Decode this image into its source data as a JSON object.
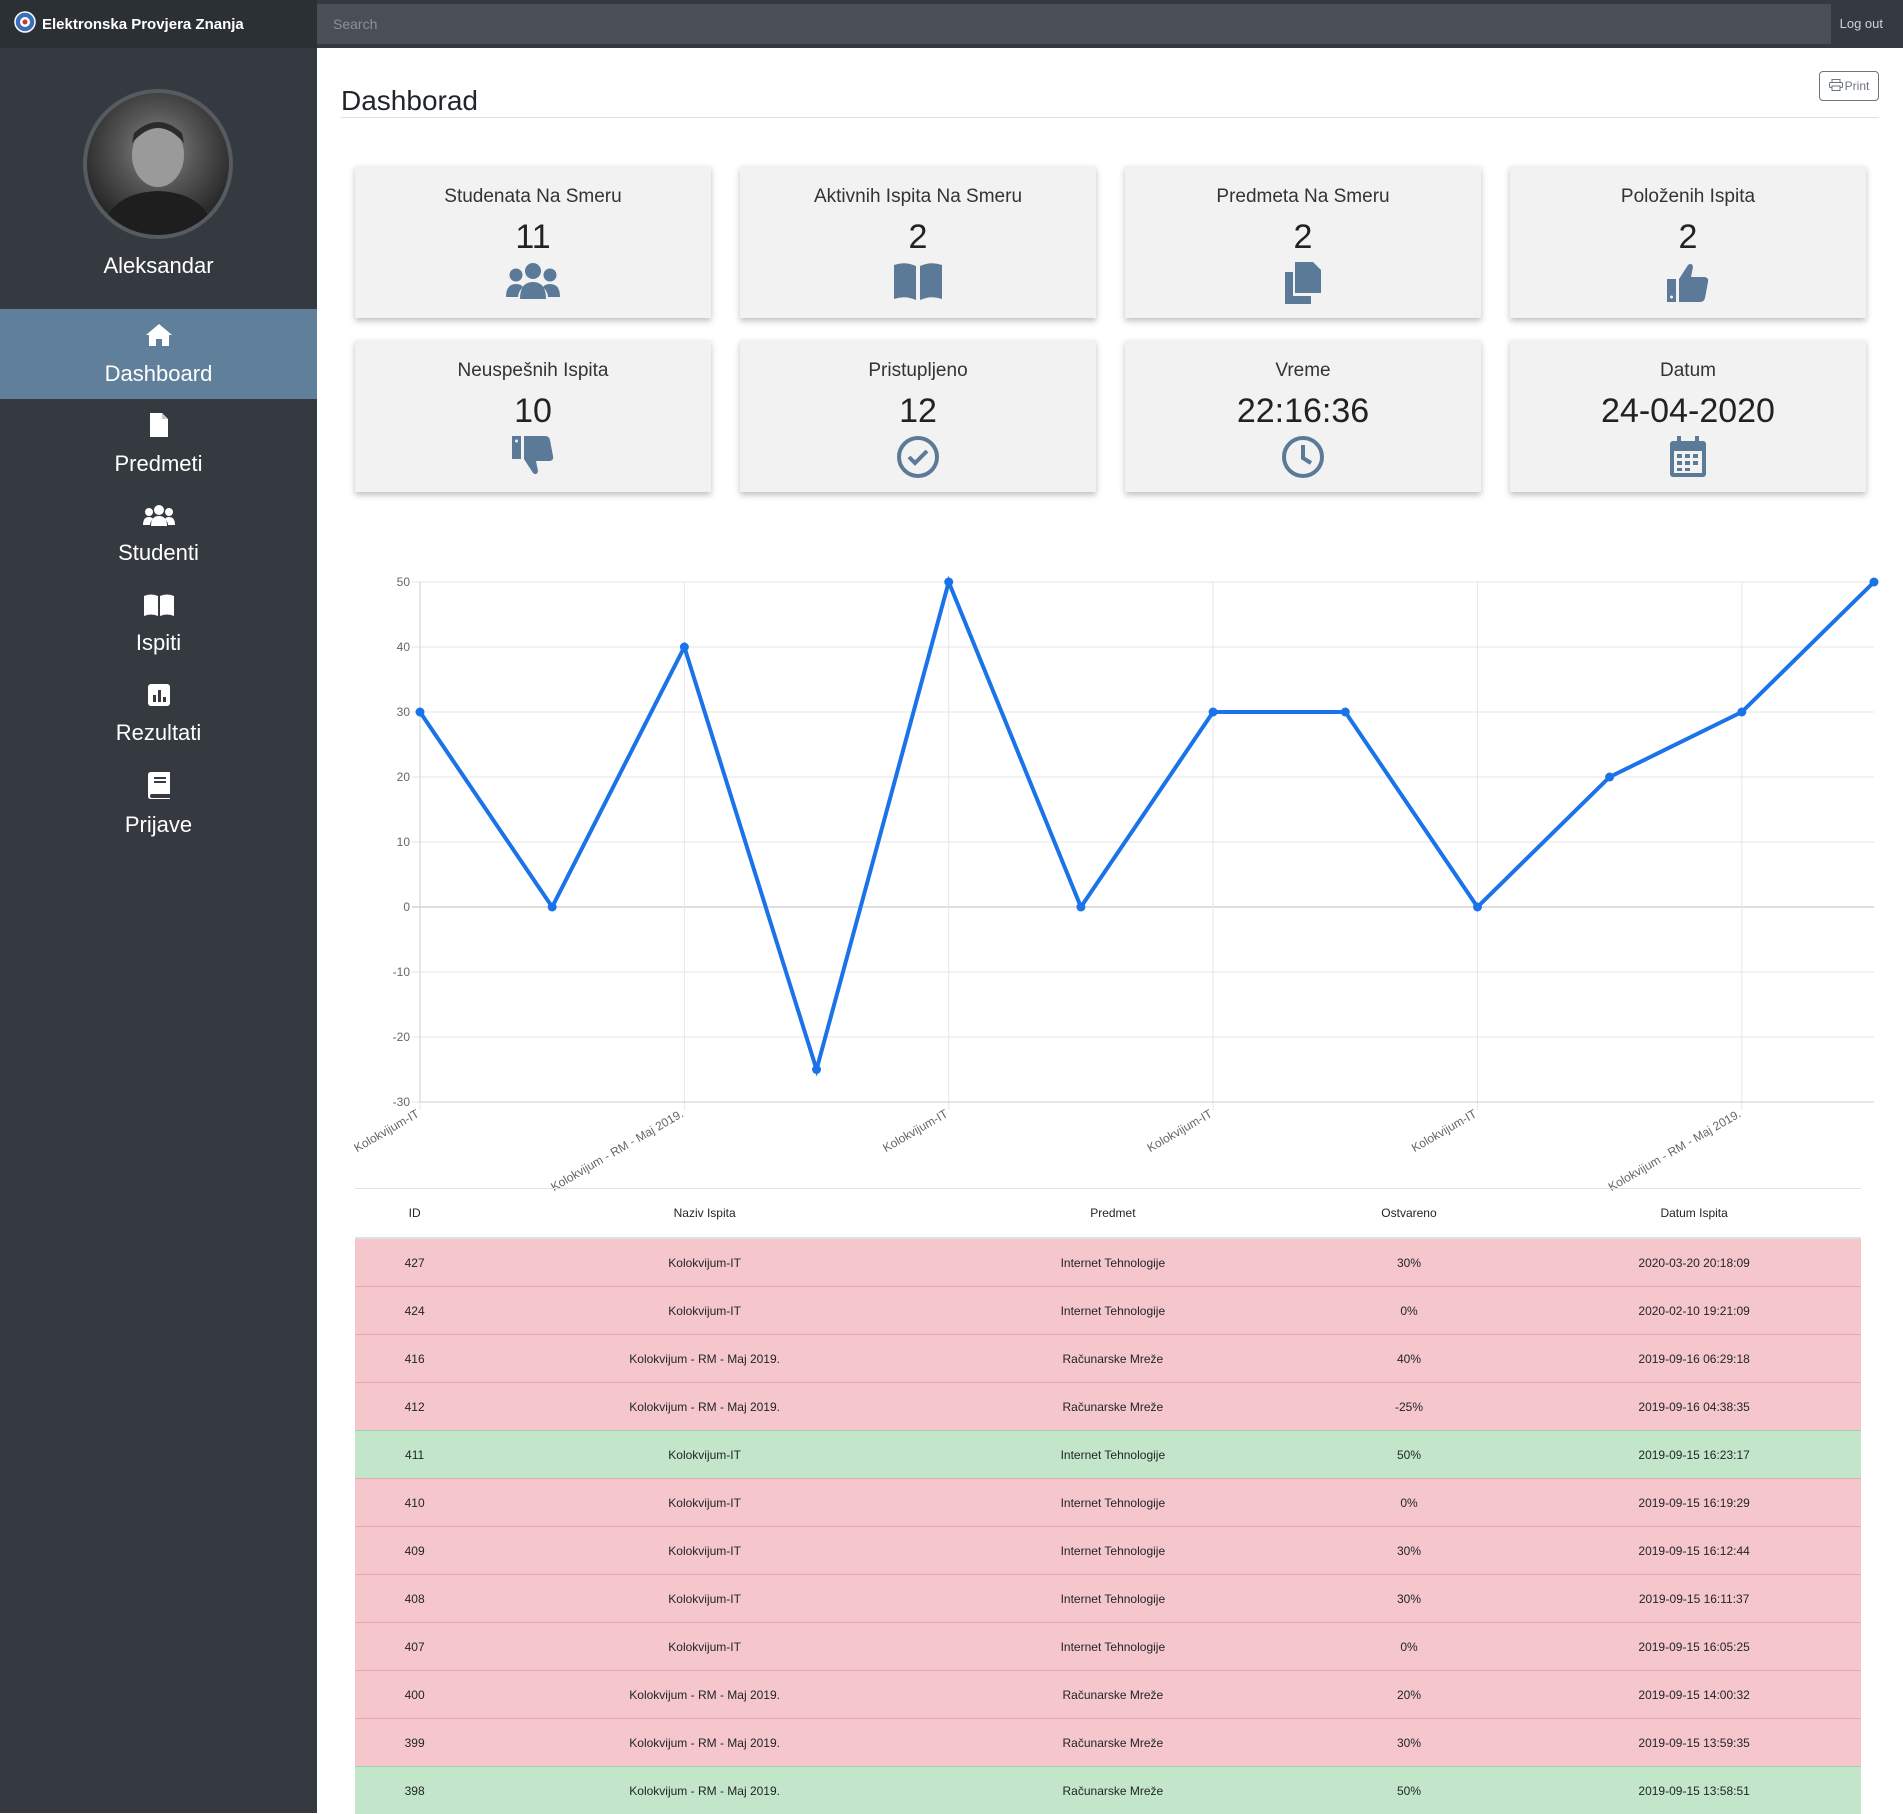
{
  "app": {
    "brand": "Elektronska Provjera Znanja",
    "search_placeholder": "Search",
    "logout": "Log out"
  },
  "sidebar": {
    "username": "Aleksandar",
    "items": [
      {
        "label": "Dashboard",
        "icon": "home-icon",
        "active": true
      },
      {
        "label": "Predmeti",
        "icon": "file-icon",
        "active": false
      },
      {
        "label": "Studenti",
        "icon": "users-icon",
        "active": false
      },
      {
        "label": "Ispiti",
        "icon": "book-open-icon",
        "active": false
      },
      {
        "label": "Rezultati",
        "icon": "chart-icon",
        "active": false
      },
      {
        "label": "Prijave",
        "icon": "book-icon",
        "active": false
      }
    ]
  },
  "main": {
    "title": "Dashborad",
    "print_label": "Print"
  },
  "cards": [
    {
      "title": "Studenata Na Smeru",
      "value": "11",
      "icon": "users-icon"
    },
    {
      "title": "Aktivnih Ispita Na Smeru",
      "value": "2",
      "icon": "book-open-icon"
    },
    {
      "title": "Predmeta Na Smeru",
      "value": "2",
      "icon": "copy-icon"
    },
    {
      "title": "Položenih Ispita",
      "value": "2",
      "icon": "thumbs-up-icon"
    },
    {
      "title": "Neuspešnih Ispita",
      "value": "10",
      "icon": "thumbs-down-icon"
    },
    {
      "title": "Pristupljeno",
      "value": "12",
      "icon": "check-circle-icon"
    },
    {
      "title": "Vreme",
      "value": "22:16:36",
      "icon": "clock-icon"
    },
    {
      "title": "Datum",
      "value": "24-04-2020",
      "icon": "calendar-icon"
    }
  ],
  "colors": {
    "icon": "#5b7a97",
    "line": "#1a73e8",
    "fail_row": "#f5c6cb",
    "pass_row": "#c3e6cb",
    "sidebar_active": "#5f7f9b"
  },
  "chart_data": {
    "type": "line",
    "x": [
      "Kolokvijum-IT",
      "Kolokvijum-IT",
      "Kolokvijum - RM - Maj 2019.",
      "Kolokvijum - RM - Maj 2019.",
      "Kolokvijum-IT",
      "Kolokvijum-IT",
      "Kolokvijum-IT",
      "Kolokvijum-IT",
      "Kolokvijum-IT",
      "Kolokvijum - RM - Maj 2019.",
      "Kolokvijum - RM - Maj 2019.",
      "Kolokvijum - RM - Maj 2019."
    ],
    "tick_labels": [
      "Kolokvijum-IT",
      "Kolokvijum - RM - Maj 2019.",
      "Kolokvijum-IT",
      "Kolokvijum-IT",
      "Kolokvijum-IT",
      "Kolokvijum - RM - Maj 2019."
    ],
    "values": [
      30,
      0,
      40,
      -25,
      50,
      0,
      30,
      30,
      0,
      20,
      30,
      50
    ],
    "ylim": [
      -30,
      50
    ],
    "yticks": [
      50,
      40,
      30,
      20,
      10,
      0,
      -10,
      -20,
      -30
    ],
    "grid": true,
    "title": "",
    "xlabel": "",
    "ylabel": ""
  },
  "table": {
    "headers": [
      "ID",
      "Naziv Ispita",
      "Predmet",
      "Ostvareno",
      "Datum Ispita"
    ],
    "rows": [
      {
        "id": "427",
        "naziv": "Kolokvijum-IT",
        "predmet": "Internet Tehnologije",
        "ostvareno": "30%",
        "datum": "2020-03-20 20:18:09",
        "status": "bad"
      },
      {
        "id": "424",
        "naziv": "Kolokvijum-IT",
        "predmet": "Internet Tehnologije",
        "ostvareno": "0%",
        "datum": "2020-02-10 19:21:09",
        "status": "bad"
      },
      {
        "id": "416",
        "naziv": "Kolokvijum - RM - Maj 2019.",
        "predmet": "Računarske Mreže",
        "ostvareno": "40%",
        "datum": "2019-09-16 06:29:18",
        "status": "bad"
      },
      {
        "id": "412",
        "naziv": "Kolokvijum - RM - Maj 2019.",
        "predmet": "Računarske Mreže",
        "ostvareno": "-25%",
        "datum": "2019-09-16 04:38:35",
        "status": "bad"
      },
      {
        "id": "411",
        "naziv": "Kolokvijum-IT",
        "predmet": "Internet Tehnologije",
        "ostvareno": "50%",
        "datum": "2019-09-15 16:23:17",
        "status": "good"
      },
      {
        "id": "410",
        "naziv": "Kolokvijum-IT",
        "predmet": "Internet Tehnologije",
        "ostvareno": "0%",
        "datum": "2019-09-15 16:19:29",
        "status": "bad"
      },
      {
        "id": "409",
        "naziv": "Kolokvijum-IT",
        "predmet": "Internet Tehnologije",
        "ostvareno": "30%",
        "datum": "2019-09-15 16:12:44",
        "status": "bad"
      },
      {
        "id": "408",
        "naziv": "Kolokvijum-IT",
        "predmet": "Internet Tehnologije",
        "ostvareno": "30%",
        "datum": "2019-09-15 16:11:37",
        "status": "bad"
      },
      {
        "id": "407",
        "naziv": "Kolokvijum-IT",
        "predmet": "Internet Tehnologije",
        "ostvareno": "0%",
        "datum": "2019-09-15 16:05:25",
        "status": "bad"
      },
      {
        "id": "400",
        "naziv": "Kolokvijum - RM - Maj 2019.",
        "predmet": "Računarske Mreže",
        "ostvareno": "20%",
        "datum": "2019-09-15 14:00:32",
        "status": "bad"
      },
      {
        "id": "399",
        "naziv": "Kolokvijum - RM - Maj 2019.",
        "predmet": "Računarske Mreže",
        "ostvareno": "30%",
        "datum": "2019-09-15 13:59:35",
        "status": "bad"
      },
      {
        "id": "398",
        "naziv": "Kolokvijum - RM - Maj 2019.",
        "predmet": "Računarske Mreže",
        "ostvareno": "50%",
        "datum": "2019-09-15 13:58:51",
        "status": "good"
      }
    ]
  }
}
